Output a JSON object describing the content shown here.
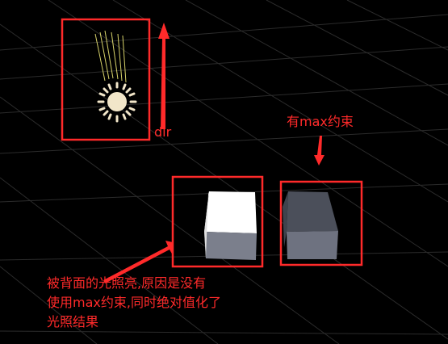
{
  "colors": {
    "background": "#000000",
    "grid": "#2b2b2b",
    "annotation": "#ff2a2a",
    "sun": "#f2e6c9",
    "sun_rays": "#d8d36a",
    "lit_cube_top": "#ffffff",
    "lit_cube_side": "#7b7f8c",
    "dark_cube_top": "#4b4f5a",
    "dark_cube_side": "#6e7280"
  },
  "annotations": {
    "dir_label": "dir",
    "max_label": "有max约束",
    "note_lines": [
      "被背面的光照亮,原因是没有",
      "使用max约束,同时绝对值化了",
      "光照结果"
    ]
  },
  "icons": {
    "light": "sun-icon"
  }
}
